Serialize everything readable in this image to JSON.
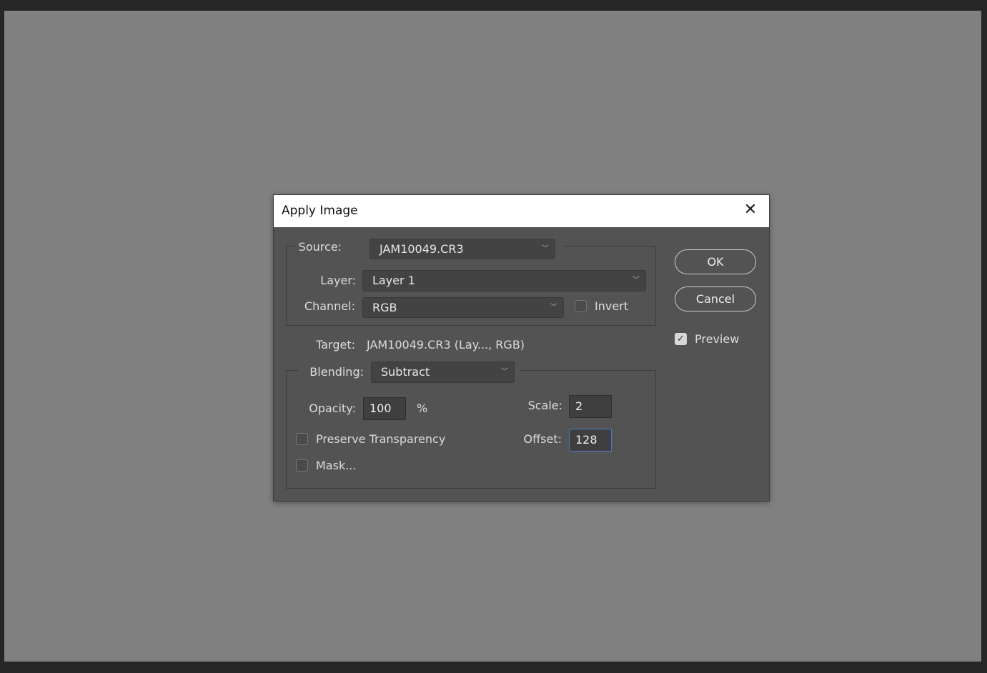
{
  "dialog": {
    "title": "Apply Image",
    "close_icon": "close-icon"
  },
  "source": {
    "label": "Source:",
    "value": "JAM10049.CR3"
  },
  "layer": {
    "label": "Layer:",
    "value": "Layer 1"
  },
  "channel": {
    "label": "Channel:",
    "value": "RGB"
  },
  "invert": {
    "label": "Invert",
    "checked": false
  },
  "target": {
    "label": "Target:",
    "value": "JAM10049.CR3 (Lay..., RGB)"
  },
  "blending": {
    "label": "Blending:",
    "value": "Subtract"
  },
  "opacity": {
    "label": "Opacity:",
    "value": "100",
    "unit": "%"
  },
  "scale": {
    "label": "Scale:",
    "value": "2"
  },
  "offset": {
    "label": "Offset:",
    "value": "128"
  },
  "preserve_transparency": {
    "label": "Preserve Transparency",
    "checked": false
  },
  "mask": {
    "label": "Mask...",
    "checked": false
  },
  "buttons": {
    "ok": "OK",
    "cancel": "Cancel"
  },
  "preview": {
    "label": "Preview",
    "checked": true
  }
}
